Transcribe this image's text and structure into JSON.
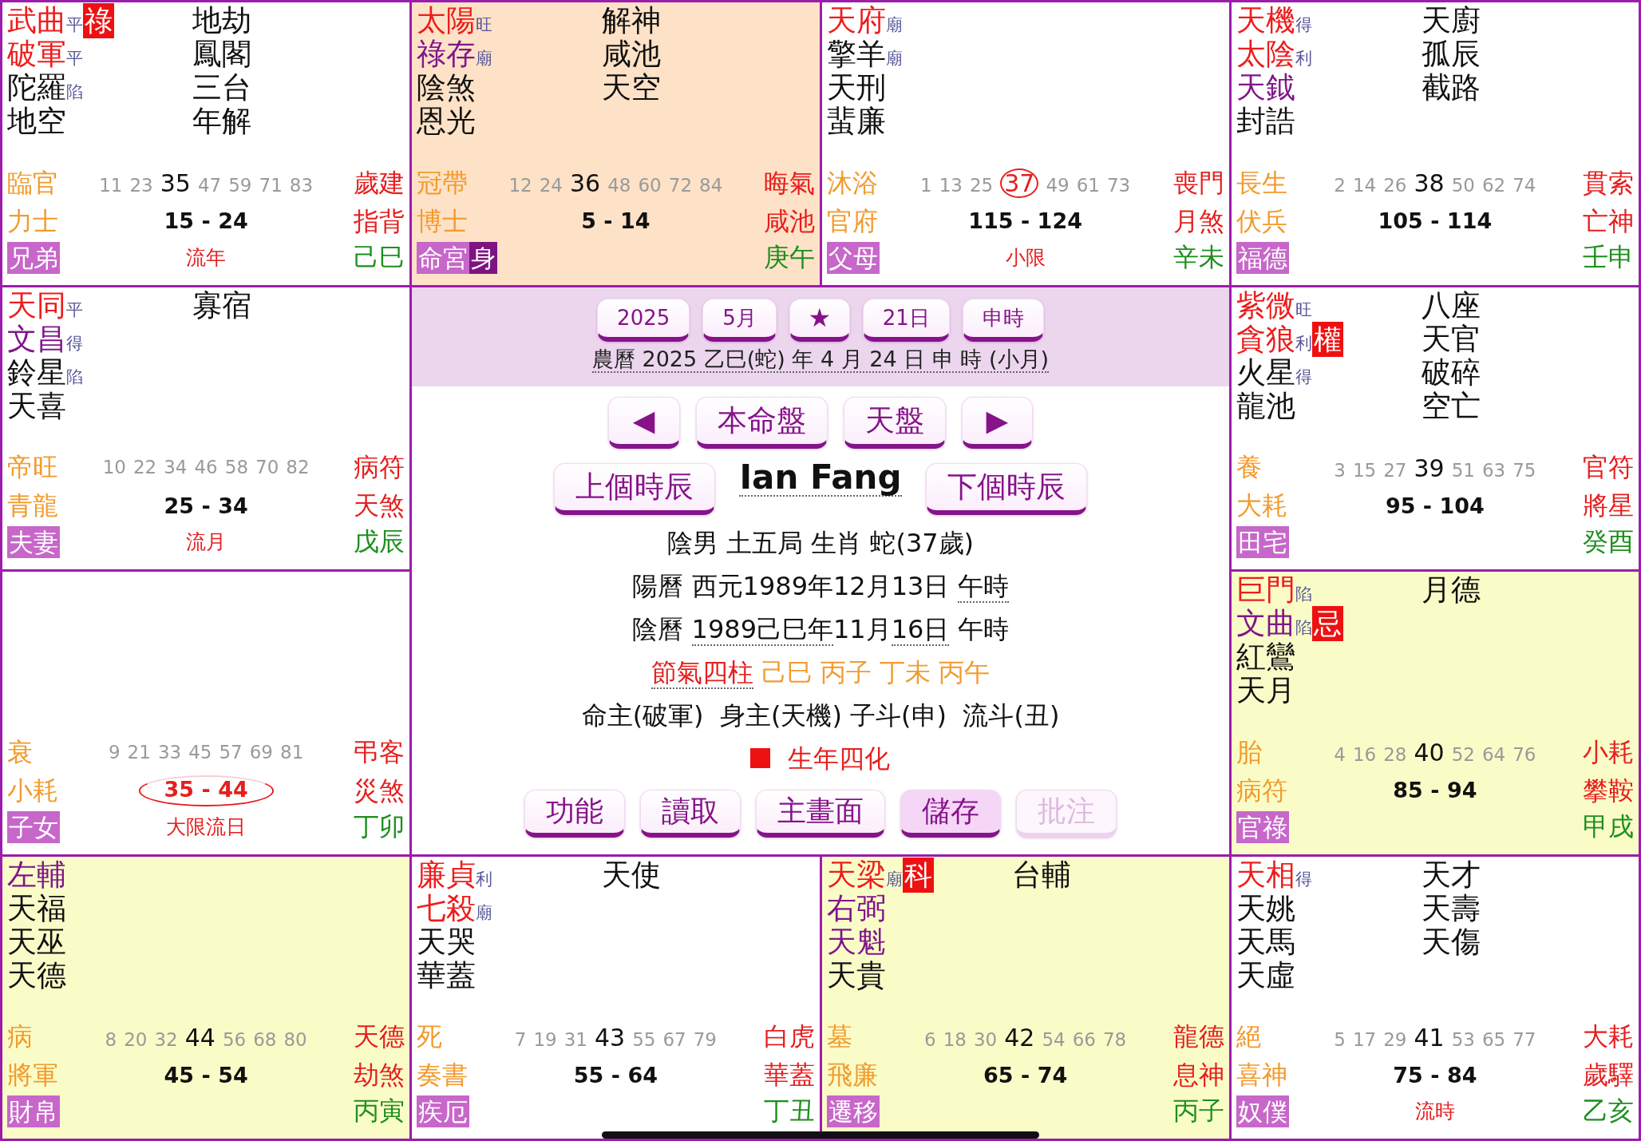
{
  "palaces": [
    {
      "selected": false,
      "highlighted": false,
      "stars": [
        {
          "name": "武曲",
          "kind": "major",
          "brightness": "平",
          "transformation": "祿"
        },
        {
          "name": "破軍",
          "kind": "major",
          "brightness": "平"
        },
        {
          "name": "陀羅",
          "kind": "minor",
          "brightness": "陷"
        },
        {
          "name": "地空",
          "kind": "minor"
        }
      ],
      "side_stars": [
        "地劫",
        "鳳閣",
        "三台",
        "年解"
      ],
      "growth_stage": "臨官",
      "ages": [
        {
          "value": "11",
          "emphasized": false,
          "current": false
        },
        {
          "value": "23",
          "emphasized": false,
          "current": false
        },
        {
          "value": "35",
          "emphasized": true,
          "current": false
        },
        {
          "value": "47",
          "emphasized": false,
          "current": false
        },
        {
          "value": "59",
          "emphasized": false,
          "current": false
        },
        {
          "value": "71",
          "emphasized": false,
          "current": false
        },
        {
          "value": "83",
          "emphasized": false,
          "current": false
        }
      ],
      "year_spirit": "歲建",
      "boshi_spirit": "力士",
      "decade": {
        "text": "15 - 24",
        "current": false
      },
      "general_spirit": "指背",
      "palace_name": "兄弟",
      "flow_marker": "流年",
      "stem_branch": "己巳"
    },
    {
      "selected": true,
      "highlighted": false,
      "stars": [
        {
          "name": "太陽",
          "kind": "major",
          "brightness": "旺"
        },
        {
          "name": "祿存",
          "kind": "auxiliary",
          "brightness": "廟"
        },
        {
          "name": "陰煞",
          "kind": "minor"
        },
        {
          "name": "恩光",
          "kind": "minor"
        }
      ],
      "side_stars": [
        "解神",
        "咸池",
        "天空"
      ],
      "growth_stage": "冠帶",
      "ages": [
        {
          "value": "12",
          "emphasized": false,
          "current": false
        },
        {
          "value": "24",
          "emphasized": false,
          "current": false
        },
        {
          "value": "36",
          "emphasized": true,
          "current": false
        },
        {
          "value": "48",
          "emphasized": false,
          "current": false
        },
        {
          "value": "60",
          "emphasized": false,
          "current": false
        },
        {
          "value": "72",
          "emphasized": false,
          "current": false
        },
        {
          "value": "84",
          "emphasized": false,
          "current": false
        }
      ],
      "year_spirit": "晦氣",
      "boshi_spirit": "博士",
      "decade": {
        "text": "5 - 14",
        "current": false
      },
      "general_spirit": "咸池",
      "palace_name": "命宮",
      "body_tag": "身",
      "stem_branch": "庚午"
    },
    {
      "selected": false,
      "highlighted": false,
      "stars": [
        {
          "name": "天府",
          "kind": "major",
          "brightness": "廟"
        },
        {
          "name": "擎羊",
          "kind": "minor",
          "brightness": "廟"
        },
        {
          "name": "天刑",
          "kind": "minor"
        },
        {
          "name": "蜚廉",
          "kind": "minor"
        }
      ],
      "growth_stage": "沐浴",
      "ages": [
        {
          "value": "1",
          "emphasized": false,
          "current": false
        },
        {
          "value": "13",
          "emphasized": false,
          "current": false
        },
        {
          "value": "25",
          "emphasized": false,
          "current": false
        },
        {
          "value": "37",
          "emphasized": true,
          "current": true
        },
        {
          "value": "49",
          "emphasized": false,
          "current": false
        },
        {
          "value": "61",
          "emphasized": false,
          "current": false
        },
        {
          "value": "73",
          "emphasized": false,
          "current": false
        }
      ],
      "year_spirit": "喪門",
      "boshi_spirit": "官府",
      "decade": {
        "text": "115 - 124",
        "current": false
      },
      "general_spirit": "月煞",
      "palace_name": "父母",
      "flow_marker": "小限",
      "stem_branch": "辛未"
    },
    {
      "selected": false,
      "highlighted": false,
      "stars": [
        {
          "name": "天機",
          "kind": "major",
          "brightness": "得"
        },
        {
          "name": "太陰",
          "kind": "major",
          "brightness": "利"
        },
        {
          "name": "天鉞",
          "kind": "auxiliary"
        },
        {
          "name": "封誥",
          "kind": "minor"
        }
      ],
      "side_stars": [
        "天廚",
        "孤辰",
        "截路"
      ],
      "growth_stage": "長生",
      "ages": [
        {
          "value": "2",
          "emphasized": false,
          "current": false
        },
        {
          "value": "14",
          "emphasized": false,
          "current": false
        },
        {
          "value": "26",
          "emphasized": false,
          "current": false
        },
        {
          "value": "38",
          "emphasized": true,
          "current": false
        },
        {
          "value": "50",
          "emphasized": false,
          "current": false
        },
        {
          "value": "62",
          "emphasized": false,
          "current": false
        },
        {
          "value": "74",
          "emphasized": false,
          "current": false
        }
      ],
      "year_spirit": "貫索",
      "boshi_spirit": "伏兵",
      "decade": {
        "text": "105 - 114",
        "current": false
      },
      "general_spirit": "亡神",
      "palace_name": "福德",
      "stem_branch": "壬申"
    },
    {
      "selected": false,
      "highlighted": false,
      "stars": [
        {
          "name": "天同",
          "kind": "major",
          "brightness": "平"
        },
        {
          "name": "文昌",
          "kind": "auxiliary",
          "brightness": "得"
        },
        {
          "name": "鈴星",
          "kind": "minor",
          "brightness": "陷"
        },
        {
          "name": "天喜",
          "kind": "minor"
        }
      ],
      "side_stars": [
        "寡宿"
      ],
      "growth_stage": "帝旺",
      "ages": [
        {
          "value": "10",
          "emphasized": false,
          "current": false
        },
        {
          "value": "22",
          "emphasized": false,
          "current": false
        },
        {
          "value": "34",
          "emphasized": false,
          "current": false
        },
        {
          "value": "46",
          "emphasized": false,
          "current": false
        },
        {
          "value": "58",
          "emphasized": false,
          "current": false
        },
        {
          "value": "70",
          "emphasized": false,
          "current": false
        },
        {
          "value": "82",
          "emphasized": false,
          "current": false
        }
      ],
      "year_spirit": "病符",
      "boshi_spirit": "青龍",
      "decade": {
        "text": "25 - 34",
        "current": false
      },
      "general_spirit": "天煞",
      "palace_name": "夫妻",
      "flow_marker": "流月",
      "stem_branch": "戊辰"
    },
    {
      "selected": false,
      "highlighted": false,
      "stars": [
        {
          "name": "紫微",
          "kind": "major",
          "brightness": "旺"
        },
        {
          "name": "貪狼",
          "kind": "major",
          "brightness": "利",
          "transformation": "權"
        },
        {
          "name": "火星",
          "kind": "minor",
          "brightness": "得"
        },
        {
          "name": "龍池",
          "kind": "minor"
        }
      ],
      "side_stars": [
        "八座",
        "天官",
        "破碎",
        "空亡"
      ],
      "growth_stage": "養",
      "ages": [
        {
          "value": "3",
          "emphasized": false,
          "current": false
        },
        {
          "value": "15",
          "emphasized": false,
          "current": false
        },
        {
          "value": "27",
          "emphasized": false,
          "current": false
        },
        {
          "value": "39",
          "emphasized": true,
          "current": false
        },
        {
          "value": "51",
          "emphasized": false,
          "current": false
        },
        {
          "value": "63",
          "emphasized": false,
          "current": false
        },
        {
          "value": "75",
          "emphasized": false,
          "current": false
        }
      ],
      "year_spirit": "官符",
      "boshi_spirit": "大耗",
      "decade": {
        "text": "95 - 104",
        "current": false
      },
      "general_spirit": "將星",
      "palace_name": "田宅",
      "stem_branch": "癸酉"
    },
    {
      "selected": false,
      "highlighted": false,
      "growth_stage": "衰",
      "ages": [
        {
          "value": "9",
          "emphasized": false,
          "current": false
        },
        {
          "value": "21",
          "emphasized": false,
          "current": false
        },
        {
          "value": "33",
          "emphasized": false,
          "current": false
        },
        {
          "value": "45",
          "emphasized": false,
          "current": false
        },
        {
          "value": "57",
          "emphasized": false,
          "current": false
        },
        {
          "value": "69",
          "emphasized": false,
          "current": false
        },
        {
          "value": "81",
          "emphasized": false,
          "current": false
        }
      ],
      "year_spirit": "弔客",
      "boshi_spirit": "小耗",
      "decade": {
        "text": "35 - 44",
        "current": true
      },
      "general_spirit": "災煞",
      "palace_name": "子女",
      "flow_marker": "大限流日",
      "stem_branch": "丁卯"
    },
    {
      "selected": false,
      "highlighted": true,
      "stars": [
        {
          "name": "巨門",
          "kind": "major",
          "brightness": "陷"
        },
        {
          "name": "文曲",
          "kind": "auxiliary",
          "brightness": "陷",
          "transformation": "忌"
        },
        {
          "name": "紅鸞",
          "kind": "minor"
        },
        {
          "name": "天月",
          "kind": "minor"
        }
      ],
      "side_stars": [
        "月德"
      ],
      "growth_stage": "胎",
      "ages": [
        {
          "value": "4",
          "emphasized": false,
          "current": false
        },
        {
          "value": "16",
          "emphasized": false,
          "current": false
        },
        {
          "value": "28",
          "emphasized": false,
          "current": false
        },
        {
          "value": "40",
          "emphasized": true,
          "current": false
        },
        {
          "value": "52",
          "emphasized": false,
          "current": false
        },
        {
          "value": "64",
          "emphasized": false,
          "current": false
        },
        {
          "value": "76",
          "emphasized": false,
          "current": false
        }
      ],
      "year_spirit": "小耗",
      "boshi_spirit": "病符",
      "decade": {
        "text": "85 - 94",
        "current": false
      },
      "general_spirit": "攀鞍",
      "palace_name": "官祿",
      "stem_branch": "甲戌"
    },
    {
      "selected": false,
      "highlighted": true,
      "stars": [
        {
          "name": "左輔",
          "kind": "auxiliary"
        },
        {
          "name": "天福",
          "kind": "minor"
        },
        {
          "name": "天巫",
          "kind": "minor"
        },
        {
          "name": "天德",
          "kind": "minor"
        }
      ],
      "growth_stage": "病",
      "ages": [
        {
          "value": "8",
          "emphasized": false,
          "current": false
        },
        {
          "value": "20",
          "emphasized": false,
          "current": false
        },
        {
          "value": "32",
          "emphasized": false,
          "current": false
        },
        {
          "value": "44",
          "emphasized": true,
          "current": false
        },
        {
          "value": "56",
          "emphasized": false,
          "current": false
        },
        {
          "value": "68",
          "emphasized": false,
          "current": false
        },
        {
          "value": "80",
          "emphasized": false,
          "current": false
        }
      ],
      "year_spirit": "天德",
      "boshi_spirit": "將軍",
      "decade": {
        "text": "45 - 54",
        "current": false
      },
      "general_spirit": "劫煞",
      "palace_name": "財帛",
      "stem_branch": "丙寅"
    },
    {
      "selected": false,
      "highlighted": false,
      "stars": [
        {
          "name": "廉貞",
          "kind": "major",
          "brightness": "利"
        },
        {
          "name": "七殺",
          "kind": "major",
          "brightness": "廟"
        },
        {
          "name": "天哭",
          "kind": "minor"
        },
        {
          "name": "華蓋",
          "kind": "minor"
        }
      ],
      "side_stars": [
        "天使"
      ],
      "growth_stage": "死",
      "ages": [
        {
          "value": "7",
          "emphasized": false,
          "current": false
        },
        {
          "value": "19",
          "emphasized": false,
          "current": false
        },
        {
          "value": "31",
          "emphasized": false,
          "current": false
        },
        {
          "value": "43",
          "emphasized": true,
          "current": false
        },
        {
          "value": "55",
          "emphasized": false,
          "current": false
        },
        {
          "value": "67",
          "emphasized": false,
          "current": false
        },
        {
          "value": "79",
          "emphasized": false,
          "current": false
        }
      ],
      "year_spirit": "白虎",
      "boshi_spirit": "奏書",
      "decade": {
        "text": "55 - 64",
        "current": false
      },
      "general_spirit": "華蓋",
      "palace_name": "疾厄",
      "stem_branch": "丁丑"
    },
    {
      "selected": false,
      "highlighted": true,
      "stars": [
        {
          "name": "天梁",
          "kind": "major",
          "brightness": "廟",
          "transformation": "科"
        },
        {
          "name": "右弼",
          "kind": "auxiliary"
        },
        {
          "name": "天魁",
          "kind": "auxiliary"
        },
        {
          "name": "天貴",
          "kind": "minor"
        }
      ],
      "side_stars": [
        "台輔"
      ],
      "growth_stage": "墓",
      "ages": [
        {
          "value": "6",
          "emphasized": false,
          "current": false
        },
        {
          "value": "18",
          "emphasized": false,
          "current": false
        },
        {
          "value": "30",
          "emphasized": false,
          "current": false
        },
        {
          "value": "42",
          "emphasized": true,
          "current": false
        },
        {
          "value": "54",
          "emphasized": false,
          "current": false
        },
        {
          "value": "66",
          "emphasized": false,
          "current": false
        },
        {
          "value": "78",
          "emphasized": false,
          "current": false
        }
      ],
      "year_spirit": "龍德",
      "boshi_spirit": "飛廉",
      "decade": {
        "text": "65 - 74",
        "current": false
      },
      "general_spirit": "息神",
      "palace_name": "遷移",
      "stem_branch": "丙子"
    },
    {
      "selected": false,
      "highlighted": false,
      "stars": [
        {
          "name": "天相",
          "kind": "major",
          "brightness": "得"
        },
        {
          "name": "天姚",
          "kind": "minor"
        },
        {
          "name": "天馬",
          "kind": "minor"
        },
        {
          "name": "天虛",
          "kind": "minor"
        }
      ],
      "side_stars": [
        "天才",
        "天壽",
        "天傷"
      ],
      "growth_stage": "絕",
      "ages": [
        {
          "value": "5",
          "emphasized": false,
          "current": false
        },
        {
          "value": "17",
          "emphasized": false,
          "current": false
        },
        {
          "value": "29",
          "emphasized": false,
          "current": false
        },
        {
          "value": "41",
          "emphasized": true,
          "current": false
        },
        {
          "value": "53",
          "emphasized": false,
          "current": false
        },
        {
          "value": "65",
          "emphasized": false,
          "current": false
        },
        {
          "value": "77",
          "emphasized": false,
          "current": false
        }
      ],
      "year_spirit": "大耗",
      "boshi_spirit": "喜神",
      "decade": {
        "text": "75 - 84",
        "current": false
      },
      "general_spirit": "歲驛",
      "palace_name": "奴僕",
      "flow_marker": "流時",
      "stem_branch": "乙亥"
    }
  ],
  "center": {
    "date_buttons": [
      {
        "label": "2025",
        "kind": "field"
      },
      {
        "label": "5月",
        "kind": "field"
      },
      {
        "label": "★",
        "kind": "symbol"
      },
      {
        "label": "21日",
        "kind": "field"
      },
      {
        "label": "申時",
        "kind": "field"
      }
    ],
    "lunar_date": "農曆 2025 乙巳(蛇) 年 4 月 24 日 申 時 (小月)",
    "nav_buttons": [
      {
        "label": "◀",
        "kind": "arrow"
      },
      {
        "label": "本命盤",
        "kind": "text"
      },
      {
        "label": "天盤",
        "kind": "text"
      },
      {
        "label": "▶",
        "kind": "arrow"
      }
    ],
    "previous_hour": "上個時辰",
    "person_name": "Ian Fang",
    "next_hour": "下個時辰",
    "info_lines": [
      {
        "segments": [
          {
            "text": "陰男 土五局 生肖 蛇(37歲)",
            "kind": "plain"
          }
        ]
      },
      {
        "segments": [
          {
            "text": "陽曆 西元1989年12月13日 ",
            "kind": "plain"
          },
          {
            "text": "午時",
            "kind": "link"
          }
        ]
      },
      {
        "segments": [
          {
            "text": "陰曆 ",
            "kind": "plain"
          },
          {
            "text": "1989己巳年",
            "kind": "link"
          },
          {
            "text": "11月",
            "kind": "plain"
          },
          {
            "text": "16日",
            "kind": "link"
          },
          {
            "text": " 午時",
            "kind": "plain"
          }
        ]
      },
      {
        "segments": [
          {
            "text": "節氣四柱",
            "kind": "label_link"
          },
          {
            "text": " 己巳 丙子 丁未 丙午",
            "kind": "pillars"
          }
        ]
      },
      {
        "segments": [
          {
            "text": "命主(破軍)  身主(天機) 子斗(申)  流斗(丑)",
            "kind": "plain"
          }
        ]
      }
    ],
    "legend": {
      "label": "生年四化"
    },
    "function_buttons": [
      {
        "label": "功能",
        "active": false,
        "disabled": false
      },
      {
        "label": "讀取",
        "active": false,
        "disabled": false
      },
      {
        "label": "主畫面",
        "active": false,
        "disabled": false
      },
      {
        "label": "儲存",
        "active": true,
        "disabled": false
      },
      {
        "label": "批注",
        "active": false,
        "disabled": true
      }
    ]
  }
}
